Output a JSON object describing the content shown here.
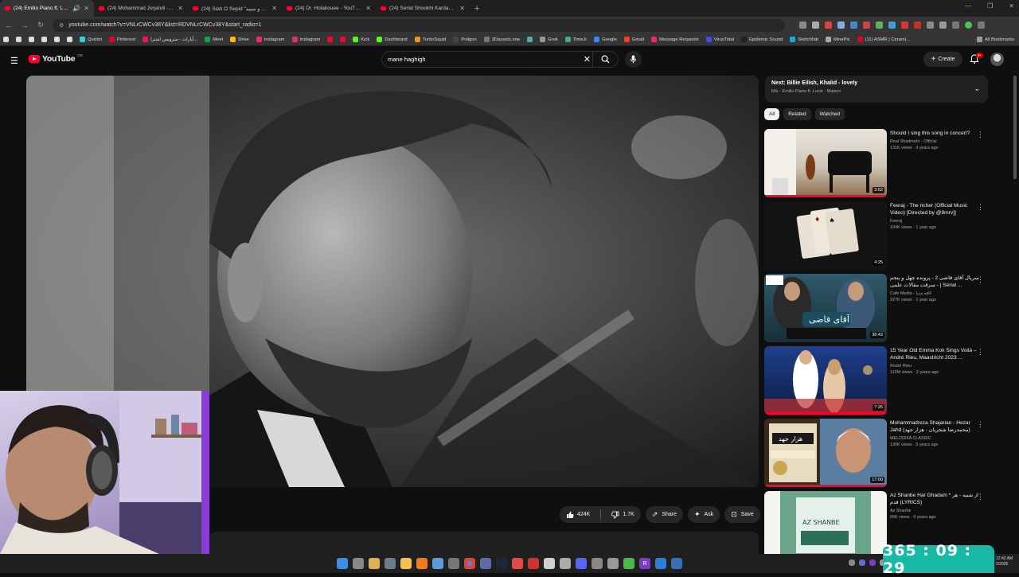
{
  "browser": {
    "tabs": [
      {
        "label": "(24) Emilio Piano ft. Lucie",
        "active": true
      },
      {
        "label": "(24) Mohammad Jorjandi - You",
        "active": false
      },
      {
        "label": "(24) Siah O Sepid \"سیاه و سپید\"",
        "active": false
      },
      {
        "label": "(24) Dr. Holakouee - YouTube",
        "active": false
      },
      {
        "label": "(24) Serial Shookhi Kardam - Pa",
        "active": false
      }
    ],
    "url": "youtube.com/watch?v=VNLrCWCv38Y&list=RDVNLrCWCv38Y&start_radio=1",
    "bookmarks": [
      {
        "label": "Quizlet",
        "color": "#3ccfcf"
      },
      {
        "label": "Pinterest",
        "color": "#e60023"
      },
      {
        "label": "آپارات - سرویس اشترا...",
        "color": "#ed145b"
      },
      {
        "label": "Meet",
        "color": "#00ac47"
      },
      {
        "label": "Drive",
        "color": "#fbbc04"
      },
      {
        "label": "Instagram",
        "color": "#e1306c"
      },
      {
        "label": "Instagram",
        "color": "#e1306c"
      },
      {
        "label": "",
        "color": "#ff0033"
      },
      {
        "label": "",
        "color": "#ff0033"
      },
      {
        "label": "Kick",
        "color": "#53fc18"
      },
      {
        "label": "Dashboard",
        "color": "#53fc18"
      },
      {
        "label": "TurboSquid",
        "color": "#f7941d"
      },
      {
        "label": "Poligon",
        "color": "#444"
      },
      {
        "label": "3Dassets.one",
        "color": "#777"
      },
      {
        "label": "",
        "color": "#5aa"
      },
      {
        "label": "Grok",
        "color": "#999"
      },
      {
        "label": "TimeJr",
        "color": "#4a8"
      },
      {
        "label": "Google",
        "color": "#4285f4"
      },
      {
        "label": "Gmail",
        "color": "#ea4335"
      },
      {
        "label": "Message Requests",
        "color": "#e1306c"
      },
      {
        "label": "VirusTotal",
        "color": "#394eff"
      },
      {
        "label": "Epidemic Sound",
        "color": "#222"
      },
      {
        "label": "Sketchfab",
        "color": "#1caad9"
      },
      {
        "label": "MinePic",
        "color": "#aaa"
      },
      {
        "label": "(11) ASMR | Cerami...",
        "color": "#e60023"
      }
    ],
    "all_bookmarks": "All Bookmarks"
  },
  "youtube": {
    "logo": "YouTube",
    "country": "GB",
    "search_query": "mane haghigh",
    "create_label": "Create",
    "notif_count": "9+"
  },
  "actions": {
    "likes": "424K",
    "dislikes": "1.7K",
    "share": "Share",
    "ask": "Ask",
    "save": "Save"
  },
  "upnext": {
    "prefix": "Next:",
    "title": "Billie Eilish, Khalid - lovely",
    "sub": "Mix · Emilio Piano ft. Lucie · Maison"
  },
  "chips": [
    "All",
    "Related",
    "Watched"
  ],
  "recommendations": [
    {
      "title": "Should I sing this song in concert?",
      "channel": "Real Shadmehr - Official",
      "meta": "131K views · 3 years ago",
      "duration": "3:52",
      "progress": 1.0
    },
    {
      "title": "Feeraj - The richer (Official Music Video) [Directed by @8mrv]]",
      "channel": "Feeraj",
      "meta": "104K views · 1 year ago",
      "duration": "4:25",
      "progress": 0
    },
    {
      "title": "سریال آقای قاضی 2 - پرونده چهل و پنجم - سرقت مقالات علمی | Serial ...",
      "channel": "Cafe Media - کافه مدیا",
      "meta": "327K views · 1 year ago",
      "duration": "38:43",
      "progress": 0
    },
    {
      "title": "15 Year Old Emma Kok Sings Voilà – André Rieu, Maastricht 2023 ...",
      "channel": "André Rieu",
      "meta": "116M views · 2 years ago",
      "duration": "7:26",
      "progress": 1.0
    },
    {
      "title": "Mohammadreza Shajarian - Hezar Jahd (محمدرضا شجریان - هزار جهد)",
      "channel": "MELODIFA CLASSIC",
      "meta": "130K views · 5 years ago",
      "duration": "17:00",
      "progress": 1.0
    },
    {
      "title": "Az Shanbe   Har Ghadam * از شنبه - هر قدم (LYRICS)",
      "channel": "Az Shanbe",
      "meta": "66K views · 6 years ago",
      "duration": "",
      "progress": 0
    }
  ],
  "overlay": {
    "timer": "365 : 09 : 29",
    "clock_time": "12:42 AM",
    "clock_date": "2/2026"
  }
}
